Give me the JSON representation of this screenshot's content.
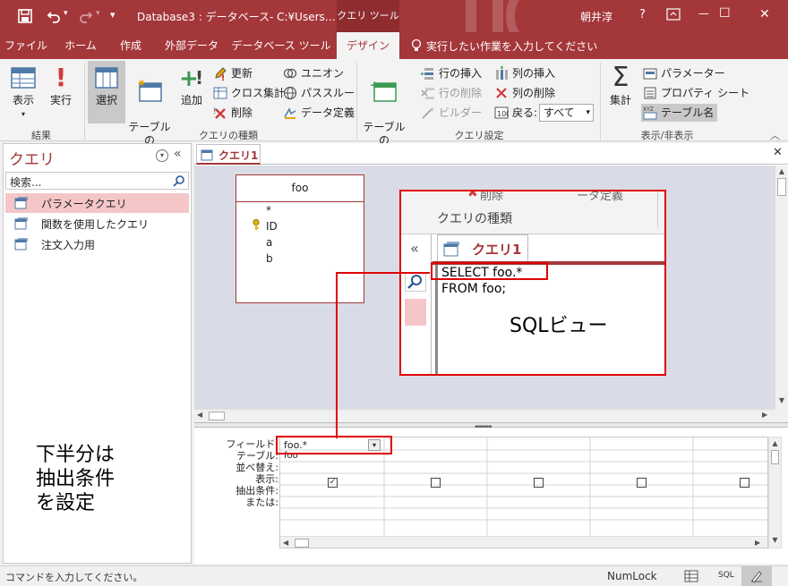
{
  "window": {
    "doc_title": "Database3 : データベース- C:¥Users…",
    "tool_context": "クエリ ツール",
    "user": "朝井淳",
    "help": "?",
    "minimize": "—",
    "maximize": "☐",
    "close": "✕",
    "qat_dropdown": "▾"
  },
  "ribbon_tabs": [
    "ファイル",
    "ホーム",
    "作成",
    "外部データ",
    "データベース ツール",
    "デザイン"
  ],
  "tell_me": "実行したい作業を入力してください",
  "groups": {
    "results": {
      "label": "結果",
      "view": "表示",
      "run": "実行"
    },
    "query_type": {
      "label": "クエリの種類",
      "select": "選択",
      "make_table": "テーブルの\n作成",
      "append": "追加",
      "update": "更新",
      "crosstab": "クロス集計",
      "delete": "削除",
      "union": "ユニオン",
      "passthrough": "パススルー",
      "data_def": "データ定義"
    },
    "query_setup": {
      "label": "クエリ設定",
      "show_table": "テーブルの\n表示",
      "insert_row": "行の挿入",
      "delete_row": "行の削除",
      "builder": "ビルダー",
      "insert_col": "列の挿入",
      "delete_col": "列の削除",
      "return_label": "戻る:",
      "return_value": "すべて"
    },
    "show_hide": {
      "label": "表示/非表示",
      "totals": "集計",
      "parameters": "パラメーター",
      "property_sheet": "プロパティ シート",
      "table_names": "テーブル名"
    }
  },
  "nav": {
    "title": "クエリ",
    "search_placeholder": "検索...",
    "items": [
      "パラメータクエリ",
      "関数を使用したクエリ",
      "注文入力用"
    ]
  },
  "doc_tab": "クエリ1",
  "table_box": {
    "name": "foo",
    "fields": [
      "*",
      "ID",
      "a",
      "b"
    ]
  },
  "inset": {
    "ribbon_fragment_1": "削除",
    "ribbon_fragment_2": "ータ定義",
    "group_label": "クエリの種類",
    "tab": "クエリ1",
    "sql_lines": [
      "SELECT foo.*",
      "FROM foo;"
    ],
    "caption": "SQLビュー",
    "chevrons": "«"
  },
  "grid": {
    "row_labels": [
      "フィールド:",
      "テーブル:",
      "並べ替え:",
      "表示:",
      "抽出条件:",
      "または:"
    ],
    "field_value": "foo.*",
    "table_value": "foo"
  },
  "annotation": {
    "lines": [
      "下半分は",
      "抽出条件",
      "を設定"
    ]
  },
  "status": {
    "left": "コマンドを入力してください。",
    "numlock": "NumLock",
    "sql": "SQL"
  },
  "colors": {
    "brand": "#a4373a",
    "highlight_red": "#e00000"
  }
}
